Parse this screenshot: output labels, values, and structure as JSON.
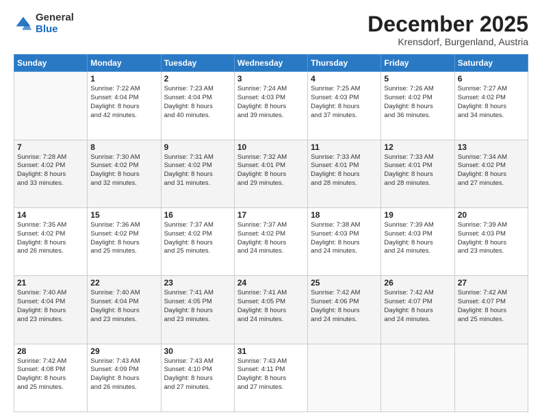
{
  "logo": {
    "general": "General",
    "blue": "Blue"
  },
  "header": {
    "month": "December 2025",
    "location": "Krensdorf, Burgenland, Austria"
  },
  "weekdays": [
    "Sunday",
    "Monday",
    "Tuesday",
    "Wednesday",
    "Thursday",
    "Friday",
    "Saturday"
  ],
  "weeks": [
    [
      {
        "day": "",
        "info": ""
      },
      {
        "day": "1",
        "info": "Sunrise: 7:22 AM\nSunset: 4:04 PM\nDaylight: 8 hours\nand 42 minutes."
      },
      {
        "day": "2",
        "info": "Sunrise: 7:23 AM\nSunset: 4:04 PM\nDaylight: 8 hours\nand 40 minutes."
      },
      {
        "day": "3",
        "info": "Sunrise: 7:24 AM\nSunset: 4:03 PM\nDaylight: 8 hours\nand 39 minutes."
      },
      {
        "day": "4",
        "info": "Sunrise: 7:25 AM\nSunset: 4:03 PM\nDaylight: 8 hours\nand 37 minutes."
      },
      {
        "day": "5",
        "info": "Sunrise: 7:26 AM\nSunset: 4:02 PM\nDaylight: 8 hours\nand 36 minutes."
      },
      {
        "day": "6",
        "info": "Sunrise: 7:27 AM\nSunset: 4:02 PM\nDaylight: 8 hours\nand 34 minutes."
      }
    ],
    [
      {
        "day": "7",
        "info": "Sunrise: 7:28 AM\nSunset: 4:02 PM\nDaylight: 8 hours\nand 33 minutes."
      },
      {
        "day": "8",
        "info": "Sunrise: 7:30 AM\nSunset: 4:02 PM\nDaylight: 8 hours\nand 32 minutes."
      },
      {
        "day": "9",
        "info": "Sunrise: 7:31 AM\nSunset: 4:02 PM\nDaylight: 8 hours\nand 31 minutes."
      },
      {
        "day": "10",
        "info": "Sunrise: 7:32 AM\nSunset: 4:01 PM\nDaylight: 8 hours\nand 29 minutes."
      },
      {
        "day": "11",
        "info": "Sunrise: 7:33 AM\nSunset: 4:01 PM\nDaylight: 8 hours\nand 28 minutes."
      },
      {
        "day": "12",
        "info": "Sunrise: 7:33 AM\nSunset: 4:01 PM\nDaylight: 8 hours\nand 28 minutes."
      },
      {
        "day": "13",
        "info": "Sunrise: 7:34 AM\nSunset: 4:02 PM\nDaylight: 8 hours\nand 27 minutes."
      }
    ],
    [
      {
        "day": "14",
        "info": "Sunrise: 7:35 AM\nSunset: 4:02 PM\nDaylight: 8 hours\nand 26 minutes."
      },
      {
        "day": "15",
        "info": "Sunrise: 7:36 AM\nSunset: 4:02 PM\nDaylight: 8 hours\nand 25 minutes."
      },
      {
        "day": "16",
        "info": "Sunrise: 7:37 AM\nSunset: 4:02 PM\nDaylight: 8 hours\nand 25 minutes."
      },
      {
        "day": "17",
        "info": "Sunrise: 7:37 AM\nSunset: 4:02 PM\nDaylight: 8 hours\nand 24 minutes."
      },
      {
        "day": "18",
        "info": "Sunrise: 7:38 AM\nSunset: 4:03 PM\nDaylight: 8 hours\nand 24 minutes."
      },
      {
        "day": "19",
        "info": "Sunrise: 7:39 AM\nSunset: 4:03 PM\nDaylight: 8 hours\nand 24 minutes."
      },
      {
        "day": "20",
        "info": "Sunrise: 7:39 AM\nSunset: 4:03 PM\nDaylight: 8 hours\nand 23 minutes."
      }
    ],
    [
      {
        "day": "21",
        "info": "Sunrise: 7:40 AM\nSunset: 4:04 PM\nDaylight: 8 hours\nand 23 minutes."
      },
      {
        "day": "22",
        "info": "Sunrise: 7:40 AM\nSunset: 4:04 PM\nDaylight: 8 hours\nand 23 minutes."
      },
      {
        "day": "23",
        "info": "Sunrise: 7:41 AM\nSunset: 4:05 PM\nDaylight: 8 hours\nand 23 minutes."
      },
      {
        "day": "24",
        "info": "Sunrise: 7:41 AM\nSunset: 4:05 PM\nDaylight: 8 hours\nand 24 minutes."
      },
      {
        "day": "25",
        "info": "Sunrise: 7:42 AM\nSunset: 4:06 PM\nDaylight: 8 hours\nand 24 minutes."
      },
      {
        "day": "26",
        "info": "Sunrise: 7:42 AM\nSunset: 4:07 PM\nDaylight: 8 hours\nand 24 minutes."
      },
      {
        "day": "27",
        "info": "Sunrise: 7:42 AM\nSunset: 4:07 PM\nDaylight: 8 hours\nand 25 minutes."
      }
    ],
    [
      {
        "day": "28",
        "info": "Sunrise: 7:42 AM\nSunset: 4:08 PM\nDaylight: 8 hours\nand 25 minutes."
      },
      {
        "day": "29",
        "info": "Sunrise: 7:43 AM\nSunset: 4:09 PM\nDaylight: 8 hours\nand 26 minutes."
      },
      {
        "day": "30",
        "info": "Sunrise: 7:43 AM\nSunset: 4:10 PM\nDaylight: 8 hours\nand 27 minutes."
      },
      {
        "day": "31",
        "info": "Sunrise: 7:43 AM\nSunset: 4:11 PM\nDaylight: 8 hours\nand 27 minutes."
      },
      {
        "day": "",
        "info": ""
      },
      {
        "day": "",
        "info": ""
      },
      {
        "day": "",
        "info": ""
      }
    ]
  ]
}
